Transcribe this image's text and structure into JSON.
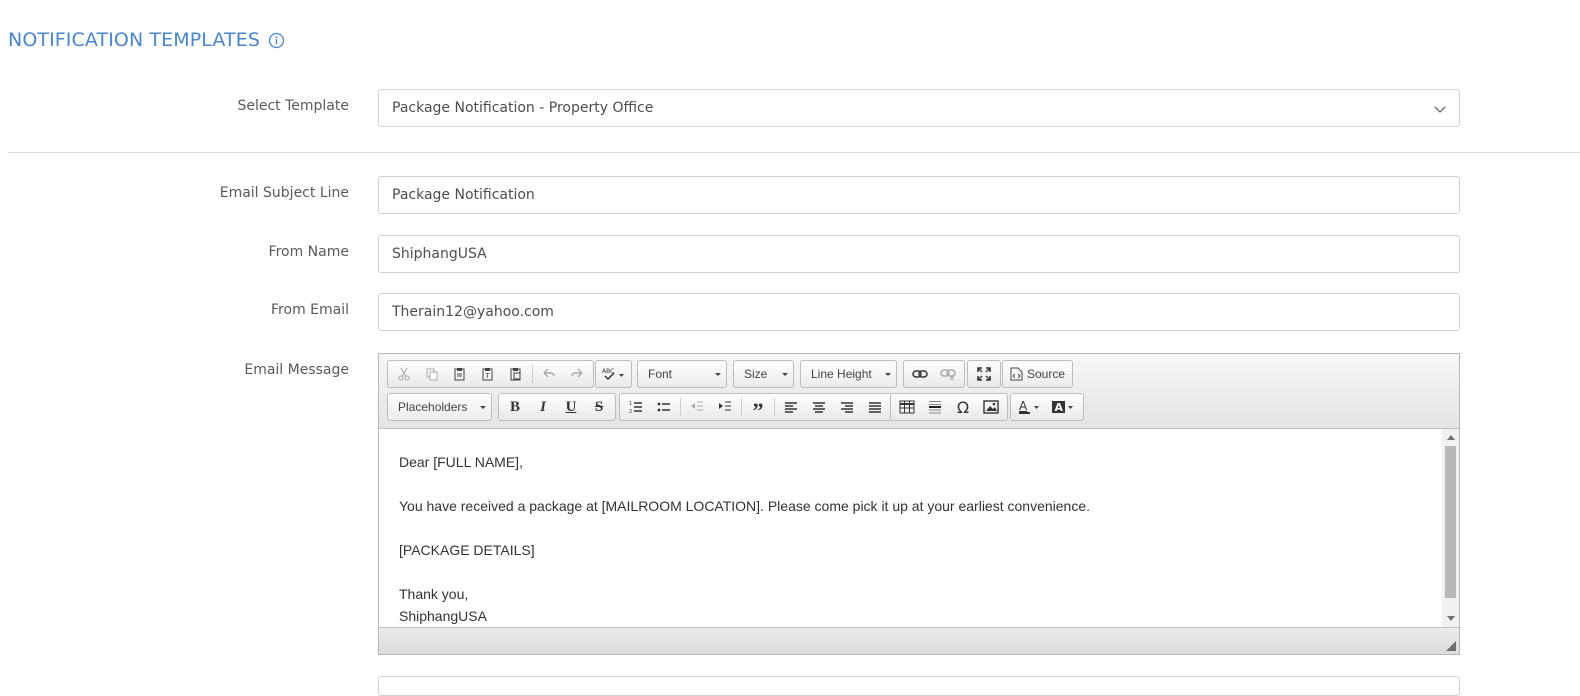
{
  "page": {
    "title": "NOTIFICATION TEMPLATES"
  },
  "template_select": {
    "label": "Select Template",
    "value": "Package Notification - Property Office"
  },
  "subject": {
    "label": "Email Subject Line",
    "value": "Package Notification"
  },
  "from_name": {
    "label": "From Name",
    "value": "ShiphangUSA"
  },
  "from_email": {
    "label": "From Email",
    "value": "Therain12@yahoo.com"
  },
  "message": {
    "label": "Email Message",
    "toolbar": {
      "font": "Font",
      "size": "Size",
      "line_height": "Line Height",
      "source": "Source",
      "placeholders": "Placeholders"
    },
    "lines": [
      "Dear [FULL NAME],",
      "You have received a package at [MAILROOM LOCATION]. Please come pick it up at your earliest convenience.",
      "[PACKAGE DETAILS]",
      "Thank you,",
      "ShiphangUSA"
    ]
  },
  "colors": {
    "title_blue": "#4a86c8",
    "field_border": "#cfd3d8"
  }
}
